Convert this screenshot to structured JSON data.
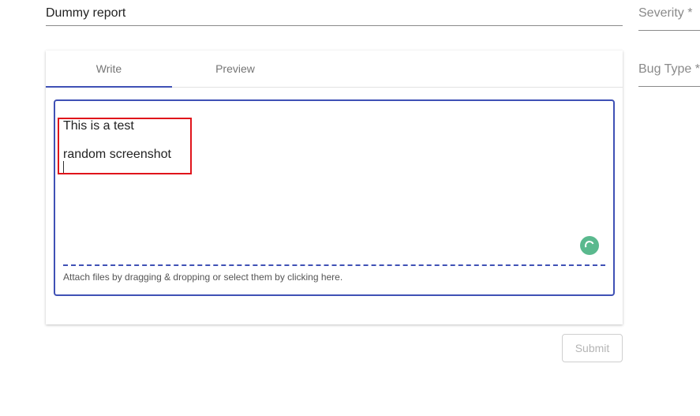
{
  "form": {
    "title_value": "Dummy report",
    "severity_label": "Severity *",
    "bug_type_label": "Bug Type *"
  },
  "tabs": [
    {
      "label": "Write",
      "active": true
    },
    {
      "label": "Preview",
      "active": false
    }
  ],
  "editor": {
    "lines": [
      "This is a test",
      "random screenshot"
    ],
    "attach_hint": "Attach files by dragging & dropping or select them by clicking here."
  },
  "actions": {
    "submit_label": "Submit",
    "submit_disabled": true
  },
  "colors": {
    "accent": "#3f51b5",
    "highlight_box": "#e0141b",
    "spinner": "#5ab98e",
    "disabled_text": "#b5b5b5"
  },
  "icons": {
    "spinner": "loading-spinner-icon"
  }
}
